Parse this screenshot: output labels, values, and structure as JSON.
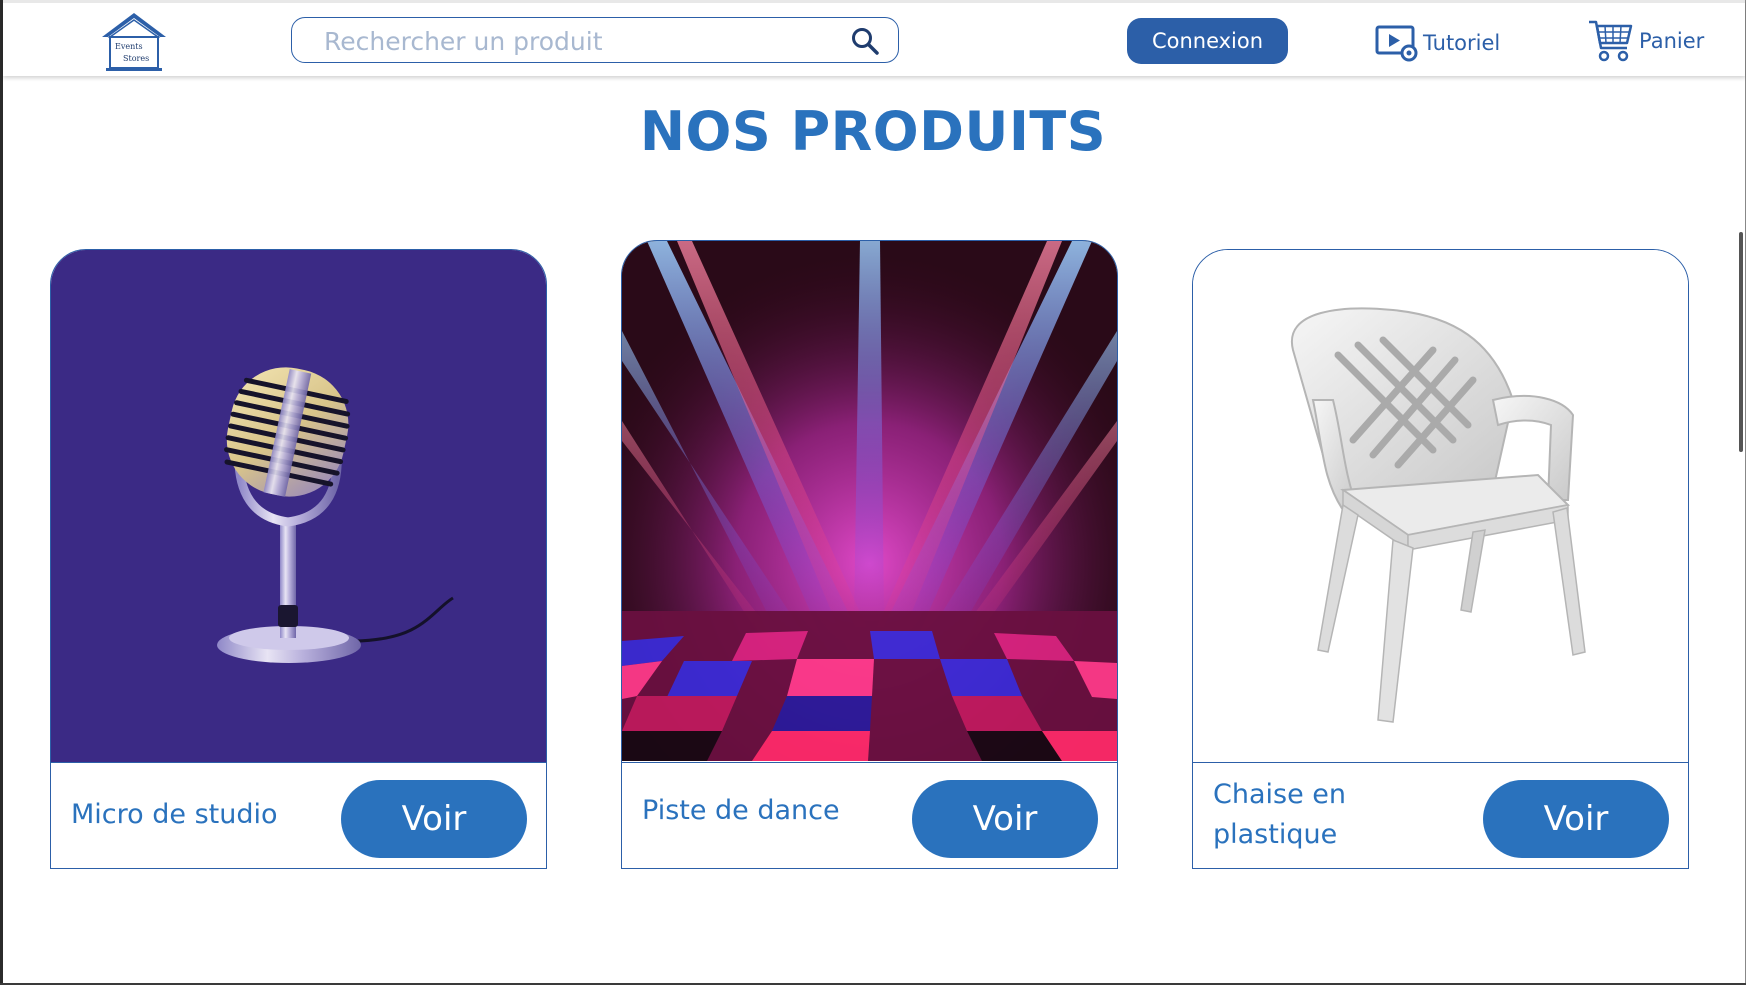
{
  "header": {
    "logo_line1": "Events",
    "logo_line2": "Stores",
    "search_placeholder": "Rechercher un produit",
    "login_label": "Connexion",
    "tutorial_label": "Tutoriel",
    "cart_label": "Panier"
  },
  "page": {
    "title": "NOS PRODUITS"
  },
  "products": [
    {
      "name": "Micro de studio",
      "button": "Voir",
      "image": "microphone-image"
    },
    {
      "name": "Piste de dance",
      "button": "Voir",
      "image": "dance-floor-image"
    },
    {
      "name": "Chaise en plastique",
      "button": "Voir",
      "image": "plastic-chair-image"
    }
  ],
  "colors": {
    "brand_blue": "#2a72bd",
    "dark_blue": "#2c5fa8",
    "mic_background": "#3b2a85"
  }
}
